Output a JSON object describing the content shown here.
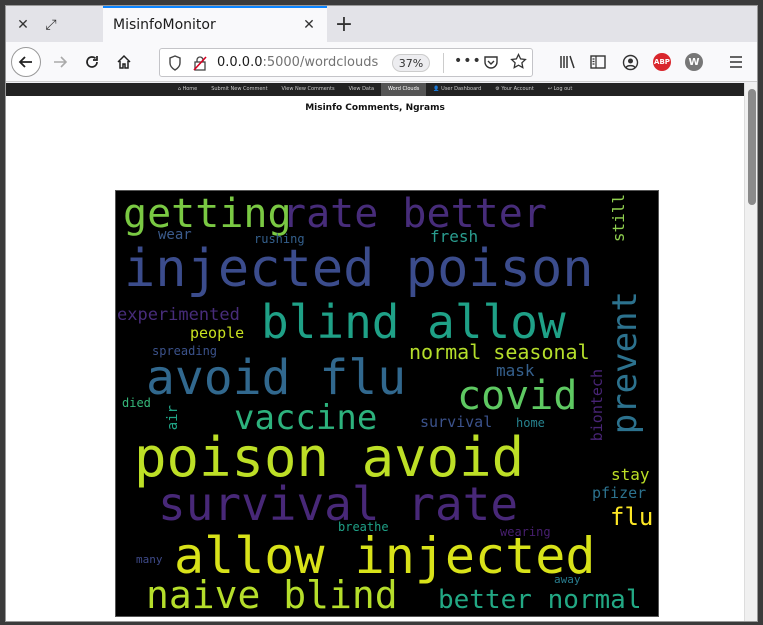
{
  "browser": {
    "tab_title": "MisinfoMonitor",
    "url_host": "0.0.0.0",
    "url_rest": ":5000/wordclouds",
    "zoom": "37%",
    "abp_label": "ABP",
    "w_label": "W"
  },
  "site_nav": [
    {
      "label": "⌂ Home"
    },
    {
      "label": "Submit New Comment"
    },
    {
      "label": "View New Comments"
    },
    {
      "label": "View Data"
    },
    {
      "label": "Word Clouds"
    },
    {
      "label": "👤 User Dashboard"
    },
    {
      "label": "⚙ Your Account"
    },
    {
      "label": "↩ Log out"
    }
  ],
  "heading": "Misinfo Comments, Ngrams",
  "wordcloud": {
    "words": [
      {
        "text": "getting",
        "color": "#7ac943"
      },
      {
        "text": "rate better",
        "color": "#472c7a"
      },
      {
        "text": "still",
        "color": "#8fcf4f"
      },
      {
        "text": "wear",
        "color": "#3b5b8c"
      },
      {
        "text": "rushing",
        "color": "#34608d"
      },
      {
        "text": "fresh",
        "color": "#2a9d8f"
      },
      {
        "text": "injected poison",
        "color": "#3b4c8c"
      },
      {
        "text": "experimented",
        "color": "#472c7a"
      },
      {
        "text": "blind allow",
        "color": "#1fa187"
      },
      {
        "text": "prevent",
        "color": "#2c728e"
      },
      {
        "text": "people",
        "color": "#c8e020"
      },
      {
        "text": "spreading",
        "color": "#3b528b"
      },
      {
        "text": "normal seasonal",
        "color": "#b5de2b"
      },
      {
        "text": "mask",
        "color": "#35608d"
      },
      {
        "text": "avoid flu",
        "color": "#31688e"
      },
      {
        "text": "covid",
        "color": "#5ec962"
      },
      {
        "text": "biontech",
        "color": "#482475"
      },
      {
        "text": "died",
        "color": "#35b779"
      },
      {
        "text": "air",
        "color": "#20a486"
      },
      {
        "text": "vaccine",
        "color": "#2db27d"
      },
      {
        "text": "survival",
        "color": "#3b528b"
      },
      {
        "text": "home",
        "color": "#26828e"
      },
      {
        "text": "poison avoid",
        "color": "#bddf26"
      },
      {
        "text": "stay",
        "color": "#bddf26"
      },
      {
        "text": "survival rate",
        "color": "#482878"
      },
      {
        "text": "pfizer",
        "color": "#2c728e"
      },
      {
        "text": "flu",
        "color": "#fde725"
      },
      {
        "text": "breathe",
        "color": "#1fa187"
      },
      {
        "text": "wearing",
        "color": "#481f70"
      },
      {
        "text": "many",
        "color": "#3e4a89"
      },
      {
        "text": "allow injected",
        "color": "#d8e219"
      },
      {
        "text": "away",
        "color": "#287c8e"
      },
      {
        "text": "naive blind",
        "color": "#b5de2b"
      },
      {
        "text": "better normal",
        "color": "#22a884"
      }
    ]
  }
}
